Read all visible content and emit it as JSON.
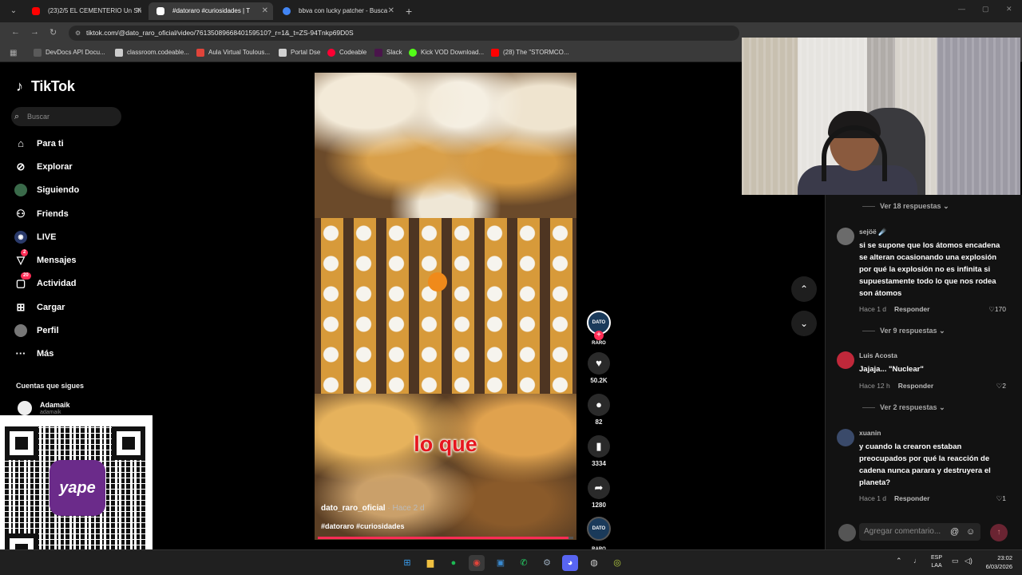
{
  "browser": {
    "tabs": [
      {
        "title": "(23)2/5 EL CEMENTERIO Un Sh",
        "active": false,
        "color": "#ff0000"
      },
      {
        "title": "#datoraro #curiosidades | T",
        "active": true,
        "color": "#ffffff"
      },
      {
        "title": "bbva con lucky patcher - Busca",
        "active": false,
        "color": "#4285f4"
      }
    ],
    "url": "tiktok.com/@dato_raro_oficial/video/7613508966840159510?_r=1&_t=ZS-94Tnkp69D0S",
    "bookmarks": [
      {
        "label": "DevDocs API Docu...",
        "color": "#5a5a5a"
      },
      {
        "label": "classroom.codeable...",
        "color": "#cccccc"
      },
      {
        "label": "Aula Virtual Toulous...",
        "color": "#e0443a"
      },
      {
        "label": "Portal Dse",
        "color": "#d0d0d0"
      },
      {
        "label": "Codeable",
        "color": "#ff0033"
      },
      {
        "label": "Slack",
        "color": "#4a154b"
      },
      {
        "label": "Kick VOD Download...",
        "color": "#53fc18"
      },
      {
        "label": "(28) The \"STORMCO...",
        "color": "#ff0000"
      }
    ]
  },
  "sidebar": {
    "logo": "TikTok",
    "search_placeholder": "Buscar",
    "nav": [
      {
        "label": "Para ti",
        "icon": "home-icon",
        "badge": ""
      },
      {
        "label": "Explorar",
        "icon": "compass-icon",
        "badge": ""
      },
      {
        "label": "Siguiendo",
        "icon": "following-icon",
        "badge": ""
      },
      {
        "label": "Friends",
        "icon": "friends-icon",
        "badge": ""
      },
      {
        "label": "LIVE",
        "icon": "live-icon",
        "badge": ""
      },
      {
        "label": "Mensajes",
        "icon": "messages-icon",
        "badge": "2"
      },
      {
        "label": "Actividad",
        "icon": "activity-icon",
        "badge": "20"
      },
      {
        "label": "Cargar",
        "icon": "upload-icon",
        "badge": ""
      },
      {
        "label": "Perfil",
        "icon": "profile-icon",
        "badge": ""
      },
      {
        "label": "Más",
        "icon": "more-icon",
        "badge": ""
      }
    ],
    "following_header": "Cuentas que sigues",
    "following": [
      {
        "name": "Adamaik",
        "handle": "adamaik"
      }
    ]
  },
  "video": {
    "caption_overlay": "lo que",
    "author": "dato_raro_oficial",
    "time": "· Hace 2 d",
    "tags": "#datoraro #curiosidades",
    "progress": 0.98,
    "creator_badge": "DATO RARO"
  },
  "actions": {
    "likes": "50.2K",
    "comments": "82",
    "saves": "3334",
    "shares": "1280"
  },
  "comments": {
    "replies_top": "Ver 18 respuestas",
    "items": [
      {
        "user": "sejöë ☄️",
        "text": "si se supone que los átomos encadena se alteran ocasionando una explosión por qué la explosión no es infinita si supuestamente todo lo que nos rodea son átomos",
        "time": "Hace 1 d",
        "reply": "Responder",
        "likes": "170",
        "replies": "Ver 9 respuestas",
        "avatar_color": "#6b6b6b"
      },
      {
        "user": "Luis Acosta",
        "text": "Jajaja... \"Nuclear\"",
        "time": "Hace 12 h",
        "reply": "Responder",
        "likes": "2",
        "replies": "Ver 2 respuestas",
        "avatar_color": "#c0283a"
      },
      {
        "user": "xuanin",
        "text": "y cuando la crearon estaban preocupados por qué la reacción de cadena nunca parara y destruyera el planeta?",
        "time": "Hace 1 d",
        "reply": "Responder",
        "likes": "1",
        "replies": "",
        "avatar_color": "#3a4a6a"
      }
    ],
    "input_placeholder": "Agregar comentario..."
  },
  "taskbar": {
    "apps": [
      {
        "icon": "windows-start-icon",
        "color": "#3a9ff0"
      },
      {
        "icon": "file-explorer-icon",
        "color": "#f0c040"
      },
      {
        "icon": "spotify-icon",
        "color": "#1db954"
      },
      {
        "icon": "chrome-icon",
        "color": "#e0443a"
      },
      {
        "icon": "photos-icon",
        "color": "#3a8ad0"
      },
      {
        "icon": "whatsapp-icon",
        "color": "#25d366"
      },
      {
        "icon": "steam-icon",
        "color": "#1b2838"
      },
      {
        "icon": "discord-icon",
        "color": "#5865f2"
      },
      {
        "icon": "obs-icon",
        "color": "#444444"
      },
      {
        "icon": "app-icon",
        "color": "#5a7a2a"
      }
    ],
    "lang_top": "ESP",
    "lang_bottom": "LAA",
    "time": "23:02",
    "date": "6/03/2026"
  }
}
